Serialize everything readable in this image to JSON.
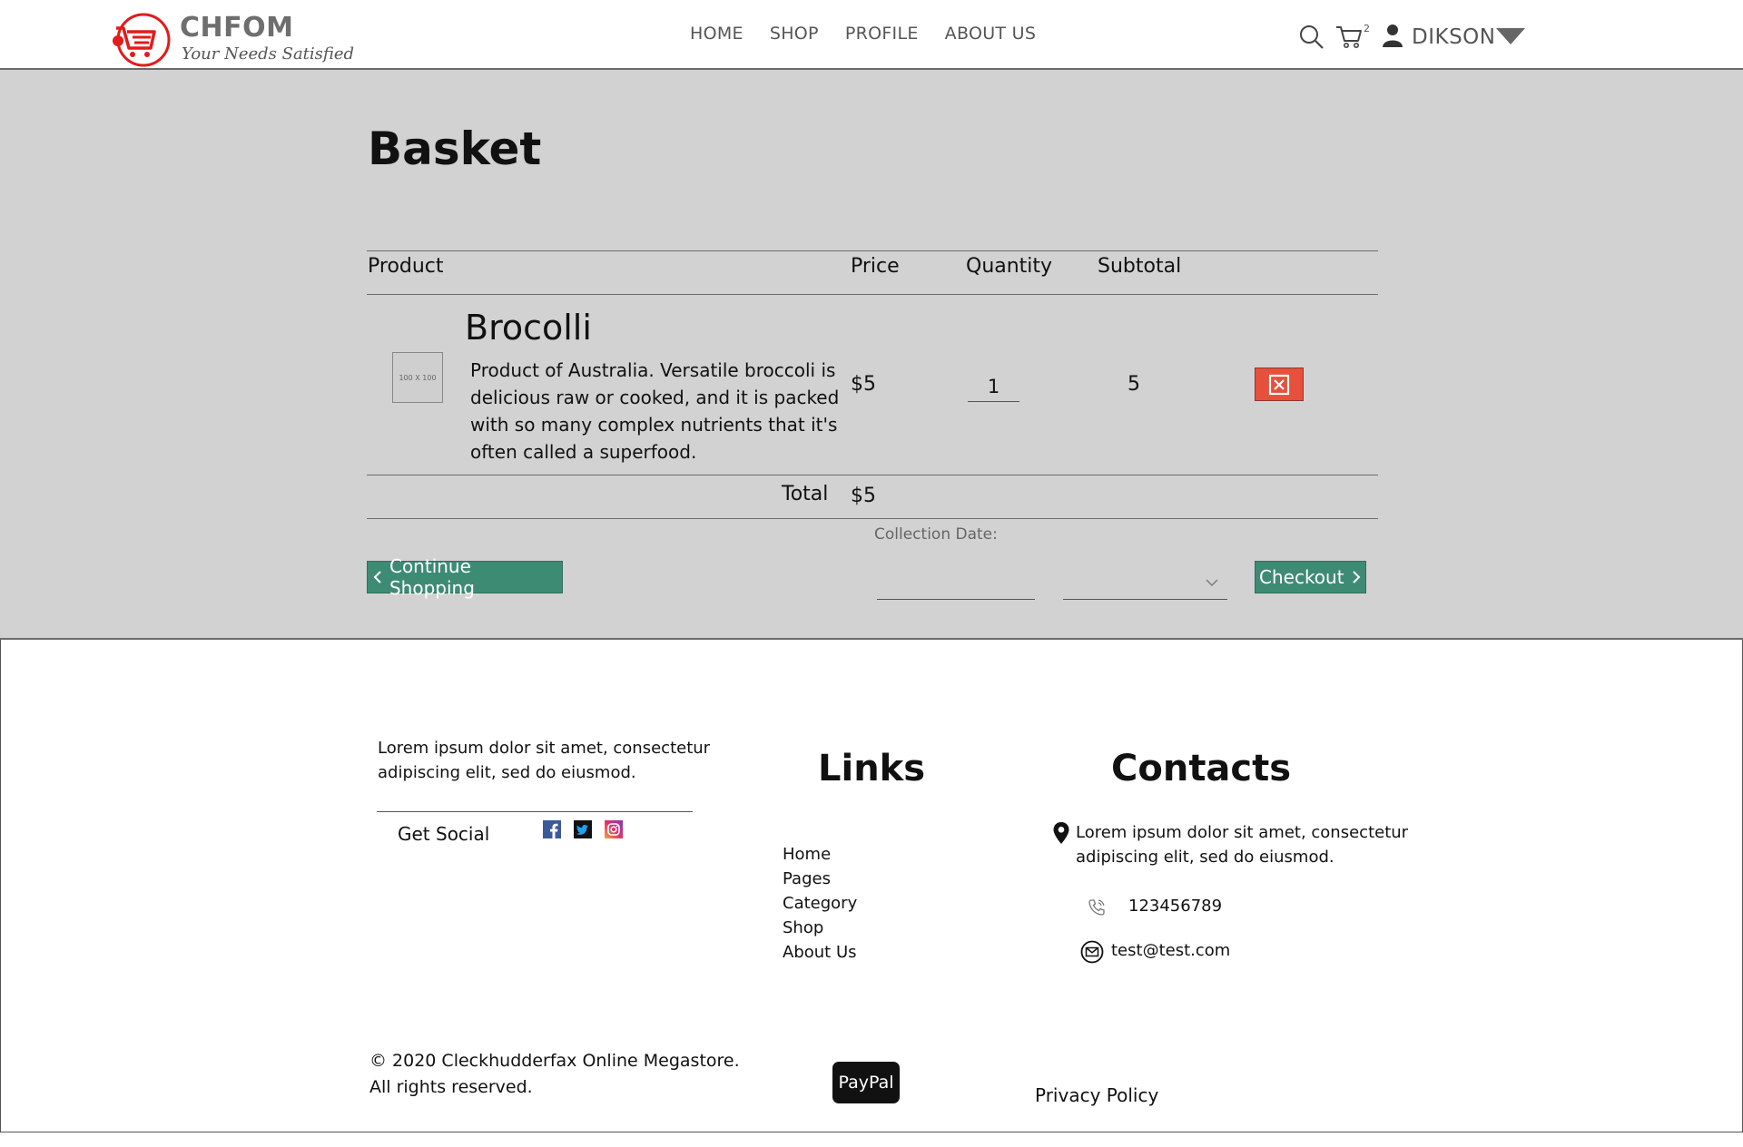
{
  "header": {
    "brand_name": "CHFOM",
    "brand_tagline": "Your Needs Satisfied",
    "nav": [
      "HOME",
      "SHOP",
      "PROFILE",
      "ABOUT US"
    ],
    "cart_count": "2",
    "username": "DIKSON",
    "icons": [
      "search-icon",
      "cart-icon",
      "user-icon",
      "chevron-down-icon"
    ]
  },
  "basket": {
    "title": "Basket",
    "columns": {
      "product": "Product",
      "price": "Price",
      "quantity": "Quantity",
      "subtotal": "Subtotal"
    },
    "items": [
      {
        "image_label": "100 X 100",
        "name": "Brocolli",
        "description": "Product of Australia. Versatile broccoli is delicious raw or cooked, and it is packed with so many complex nutrients that it's often called a superfood.",
        "price": "$5",
        "quantity": "1",
        "subtotal": "5"
      }
    ],
    "total_label": "Total",
    "total_value": "$5",
    "collection_date_label": "Collection Date:",
    "continue_label": "Continue Shopping",
    "checkout_label": "Checkout"
  },
  "footer": {
    "about": "Lorem ipsum dolor sit amet, consectetur adipiscing elit, sed do eiusmod.",
    "social_label": "Get Social",
    "social_icons": [
      "facebook-icon",
      "twitter-icon",
      "instagram-icon"
    ],
    "links_title": "Links",
    "links": [
      "Home",
      "Pages",
      "Category",
      "Shop",
      "About Us"
    ],
    "contacts_title": "Contacts",
    "address": "Lorem ipsum dolor sit amet, consectetur adipiscing elit, sed do eiusmod.",
    "phone": "123456789",
    "email": "test@test.com",
    "copyright_line1": "© 2020 Cleckhudderfax Online Megastore.",
    "copyright_line2": "All rights reserved.",
    "paypal_label": "PayPal",
    "privacy_label": "Privacy Policy"
  },
  "colors": {
    "accent_green": "#3e8b73",
    "remove_red": "#e6503c",
    "basket_bg": "#d3d2d3",
    "logo_red": "#e21b1b"
  }
}
